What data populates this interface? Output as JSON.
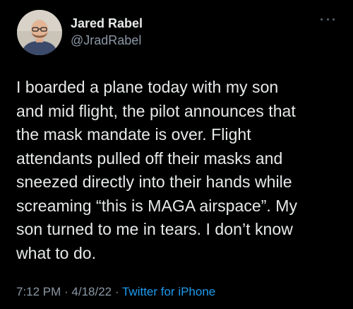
{
  "tweet": {
    "display_name": "Jared Rabel",
    "handle": "@JradRabel",
    "text_lines": [
      "I boarded a plane today with my son",
      "and mid flight, the pilot announces that",
      "the mask mandate is over. Flight",
      "attendants pulled off their masks and",
      "sneezed directly into their hands while",
      "screaming “this is MAGA airspace”. My",
      "son turned to me in tears. I don’t know",
      "what to do."
    ],
    "time": "7:12 PM",
    "separator": " · ",
    "date": "4/18/22",
    "source": "Twitter for iPhone",
    "more_icon": "more-horizontal-icon"
  },
  "colors": {
    "background": "#000000",
    "primary_text": "#e7e9ea",
    "secondary_text": "#8b98a5",
    "link": "#1d9bf0"
  }
}
